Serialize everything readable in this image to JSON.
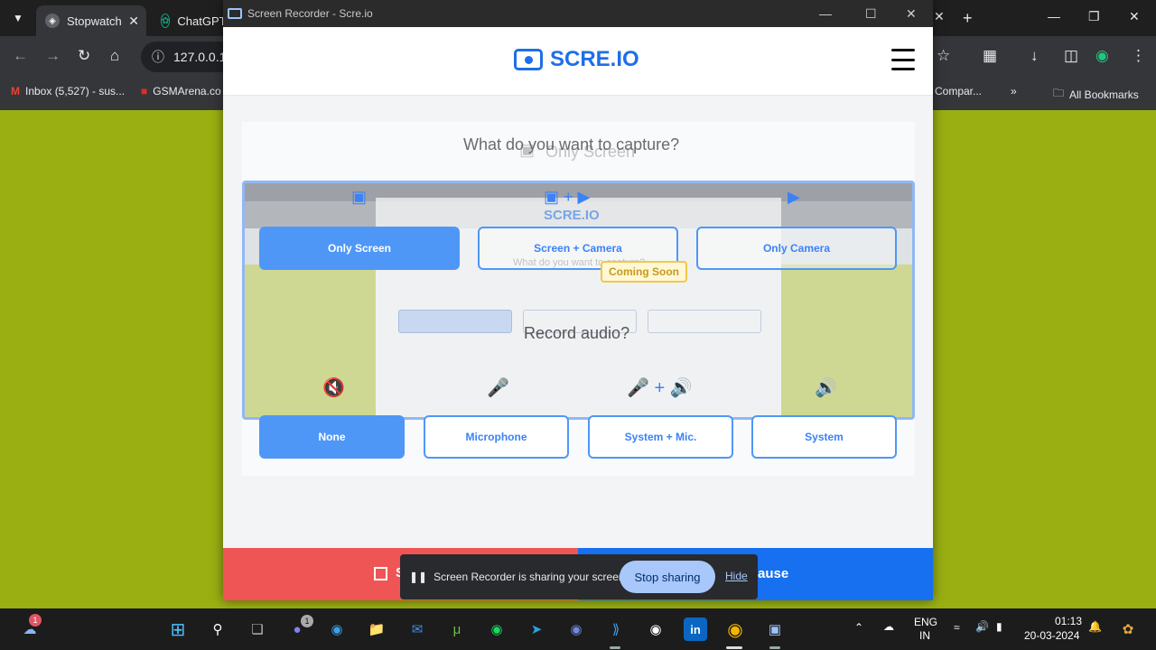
{
  "browser": {
    "tabs": [
      {
        "label": "Stopwatch",
        "active": true
      },
      {
        "label": "ChatGPT",
        "active": false
      }
    ],
    "url": "127.0.0.1",
    "bookmarks": [
      "Inbox (5,527) - sus...",
      "GSMArena.co",
      "Compar...",
      "All Bookmarks"
    ]
  },
  "recorder_window": {
    "title": "Screen Recorder - Scre.io",
    "logo": "SCRE.IO",
    "capture_question": "What do you want to capture?",
    "ghost_label": "Only Screen",
    "capture_options": [
      {
        "label": "Only Screen",
        "selected": true,
        "icon": "monitor-icon"
      },
      {
        "label": "Screen + Camera",
        "selected": false,
        "icon": "monitor-plus-camera-icon"
      },
      {
        "label": "Only Camera",
        "selected": false,
        "icon": "camera-icon"
      }
    ],
    "coming_soon": "Coming Soon",
    "audio_question": "Record audio?",
    "audio_options": [
      {
        "label": "None",
        "selected": true,
        "icon": "muted-speaker-icon"
      },
      {
        "label": "Microphone",
        "selected": false,
        "icon": "microphone-icon"
      },
      {
        "label": "System + Mic.",
        "selected": false,
        "icon": "mic-plus-speaker-icon"
      },
      {
        "label": "System",
        "selected": false,
        "icon": "speaker-icon"
      }
    ],
    "stop_label": "S",
    "pause_label": "ause"
  },
  "share_notice": {
    "message": "Screen Recorder is sharing your screen.",
    "stop_button": "Stop sharing",
    "hide_link": "Hide"
  },
  "taskbar": {
    "weather_badge": "1",
    "teams_badge": "1",
    "language": "ENG",
    "region": "IN",
    "time": "01:13",
    "date": "20-03-2024"
  },
  "colors": {
    "accent": "#1e6fe8",
    "stop_red": "#ef5555",
    "pause_blue": "#1670f0",
    "page_green": "#9aaf12"
  }
}
